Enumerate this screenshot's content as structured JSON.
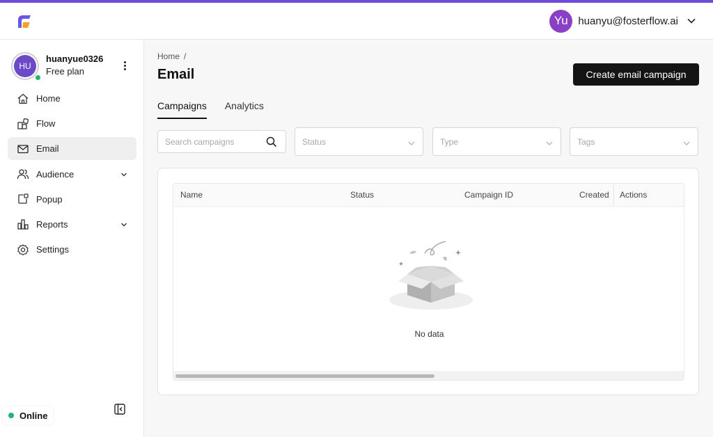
{
  "header": {
    "user_initials": "Yu",
    "user_email": "huanyu@fosterflow.ai"
  },
  "sidebar": {
    "profile": {
      "initials": "HU",
      "name": "huanyue0326",
      "plan": "Free plan"
    },
    "items": [
      {
        "label": "Home",
        "icon": "home-icon"
      },
      {
        "label": "Flow",
        "icon": "flow-icon"
      },
      {
        "label": "Email",
        "icon": "mail-icon",
        "active": true
      },
      {
        "label": "Audience",
        "icon": "users-icon",
        "expandable": true
      },
      {
        "label": "Popup",
        "icon": "popup-icon"
      },
      {
        "label": "Reports",
        "icon": "bar-chart-icon",
        "expandable": true
      },
      {
        "label": "Settings",
        "icon": "gear-icon"
      }
    ],
    "status": "Online"
  },
  "main": {
    "breadcrumb": {
      "home": "Home",
      "separator": "/"
    },
    "title": "Email",
    "create_button": "Create email campaign",
    "tabs": [
      {
        "label": "Campaigns",
        "active": true
      },
      {
        "label": "Analytics"
      }
    ],
    "filters": {
      "search_placeholder": "Search campaigns",
      "status_placeholder": "Status",
      "type_placeholder": "Type",
      "tags_placeholder": "Tags"
    },
    "table": {
      "columns": [
        "Name",
        "Status",
        "Campaign ID",
        "Created",
        "Actions"
      ],
      "rows": [],
      "empty_text": "No data"
    }
  },
  "colors": {
    "accent": "#6f4bd8",
    "user_avatar": "#8a3fc7",
    "profile_avatar": "#6b49c9",
    "online": "#22b573",
    "primary_button": "#141414"
  }
}
